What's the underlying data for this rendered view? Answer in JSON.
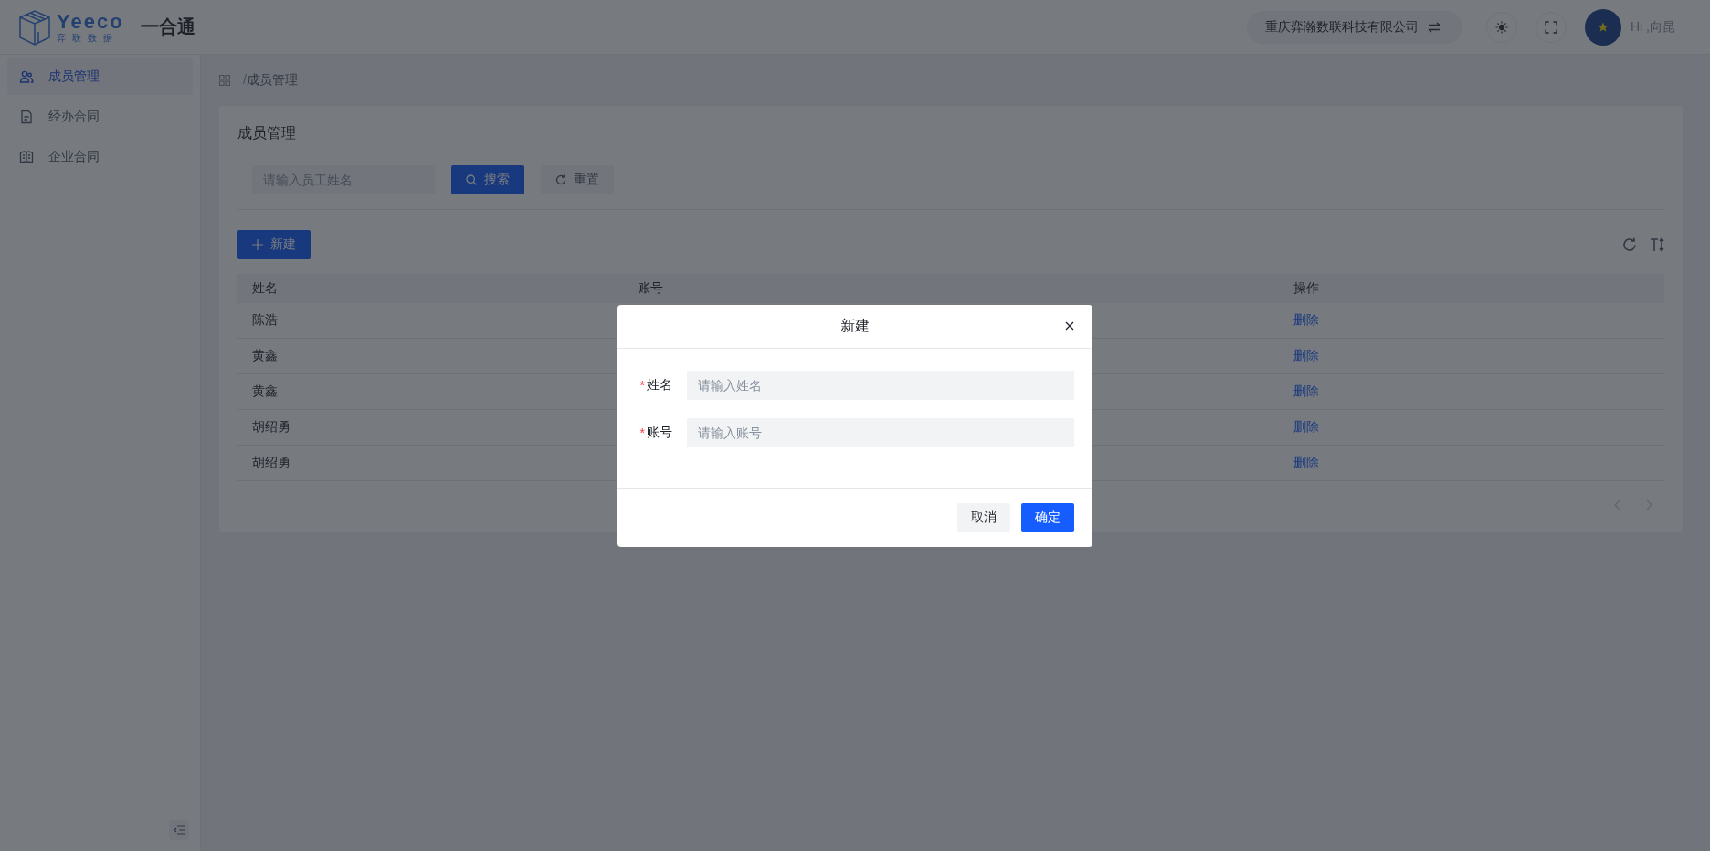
{
  "header": {
    "logo_text": "Yeeco",
    "logo_subtitle": "弈联数据",
    "app_name": "一合通",
    "company": "重庆弈瀚数联科技有限公司",
    "greeting": "Hi ,向昆"
  },
  "sidebar": {
    "items": [
      {
        "label": "成员管理",
        "selected": true,
        "kind": "people"
      },
      {
        "label": "经办合同",
        "selected": false,
        "kind": "document"
      },
      {
        "label": "企业合同",
        "selected": false,
        "kind": "book"
      }
    ]
  },
  "breadcrumb": {
    "separator": "/",
    "items": [
      "成员管理"
    ]
  },
  "card": {
    "title": "成员管理",
    "search": {
      "placeholder": "请输入员工姓名"
    },
    "search_button": "搜索",
    "reset_button": "重置",
    "new_button": "新建"
  },
  "table": {
    "columns": [
      "姓名",
      "账号",
      "操作"
    ],
    "rows": [
      {
        "name": "陈浩",
        "action": "删除"
      },
      {
        "name": "黄鑫",
        "action": "删除"
      },
      {
        "name": "黄鑫",
        "action": "删除"
      },
      {
        "name": "胡绍勇",
        "action": "删除"
      },
      {
        "name": "胡绍勇",
        "action": "删除"
      }
    ]
  },
  "dialog": {
    "title": "新建",
    "required_mark": "*",
    "fields": [
      {
        "label": "姓名",
        "required": true,
        "placeholder": "请输入姓名"
      },
      {
        "label": "账号",
        "required": true,
        "placeholder": "请输入账号"
      }
    ],
    "buttons": [
      {
        "label": "取消",
        "kind": "secondary"
      },
      {
        "label": "确定",
        "kind": "primary"
      }
    ]
  }
}
